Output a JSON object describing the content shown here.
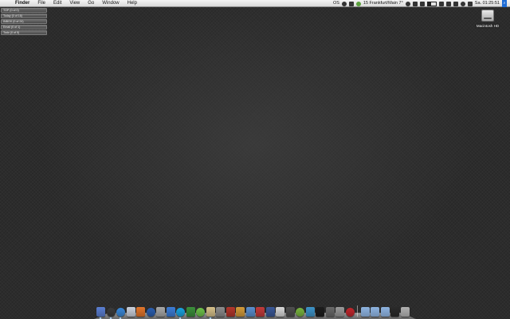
{
  "menubar": {
    "apple_glyph": "",
    "app_name": "Finder",
    "menus": [
      "File",
      "Edit",
      "View",
      "Go",
      "Window",
      "Help"
    ],
    "status": {
      "keyboard": "OS",
      "weather": "15 Frankfurt/Main 7°",
      "clock": "Sa. 01:25:51"
    }
  },
  "widgets": [
    "TOP (0 of 0)",
    "Today (0 of 16)",
    "INBOX (0 of 24)",
    "Email (0 of 1)",
    "Todo (0 of 5)"
  ],
  "desktop_icons": {
    "hd_label": "Macintosh HD"
  },
  "dock": {
    "colors": [
      "#5b7fd3",
      "#3c3c3c",
      "#3a88d8",
      "#cbd1dc",
      "#e2752b",
      "#2c5fb0",
      "#a8a8a8",
      "#3d7dd7",
      "#1aa3e0",
      "#3c8f3c",
      "#6ec24a",
      "#d6c08a",
      "#8c8c8c",
      "#b3372c",
      "#d49b3a",
      "#5a8fcf",
      "#c23b3b",
      "#3b5998",
      "#d8d8d8",
      "#4f4f4f",
      "#79b53f",
      "#3e94c9",
      "#1d1d1d",
      "#6a6a6a",
      "#9a9a9a",
      "#c2272d"
    ],
    "folder_colors": [
      "#8eb3e0",
      "#8eb3e0",
      "#8eb3e0",
      "#2a2a2a",
      "#b0b0b0"
    ]
  }
}
